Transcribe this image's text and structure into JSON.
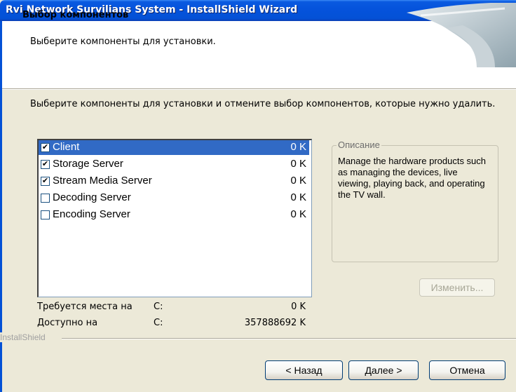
{
  "window": {
    "title": "Rvi Network Survilians System - InstallShield Wizard",
    "close_glyph": "✕"
  },
  "header": {
    "title": "Выбор компонентов",
    "subtitle": "Выберите компоненты для установки."
  },
  "instruction": "Выберите компоненты для установки и отмените выбор компонентов, которые нужно удалить.",
  "components": [
    {
      "name": "Client",
      "size": "0 K",
      "checked": true,
      "selected": true
    },
    {
      "name": "Storage Server",
      "size": "0 K",
      "checked": true,
      "selected": false
    },
    {
      "name": "Stream Media Server",
      "size": "0 K",
      "checked": true,
      "selected": false
    },
    {
      "name": "Decoding Server",
      "size": "0 K",
      "checked": false,
      "selected": false
    },
    {
      "name": "Encoding Server",
      "size": "0 K",
      "checked": false,
      "selected": false
    }
  ],
  "description": {
    "legend": "Описание",
    "text": "Manage the hardware products such as managing the devices, live viewing, playing back, and operating the TV wall."
  },
  "change_button": "Изменить...",
  "space": {
    "required_label": "Требуется места на",
    "required_drive": "C:",
    "required_value": "0 K",
    "available_label": "Доступно на",
    "available_drive": "C:",
    "available_value": "357888692 K"
  },
  "footer_label": "InstallShield",
  "buttons": {
    "back": "< Назад",
    "next": "Далее >",
    "cancel": "Отмена"
  },
  "colors": {
    "titlebar": "#0451d6",
    "selection": "#316ac5",
    "face": "#ece9d8"
  }
}
